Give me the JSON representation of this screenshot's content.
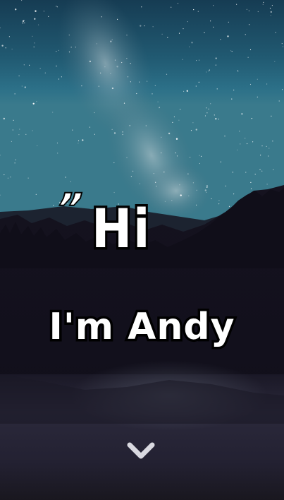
{
  "hero": {
    "quote_mark": "”",
    "greeting": "Hi",
    "intro": "I'm Andy"
  },
  "icons": {
    "scroll": "chevron-down-icon"
  },
  "colors": {
    "text": "#ffffff",
    "outline": "#000000",
    "chevron": "#d9d9e0",
    "sky_top": "#1d4a63",
    "sky_mid": "#2b6f86",
    "forest": "#13101d",
    "lake": "#2a283a"
  }
}
